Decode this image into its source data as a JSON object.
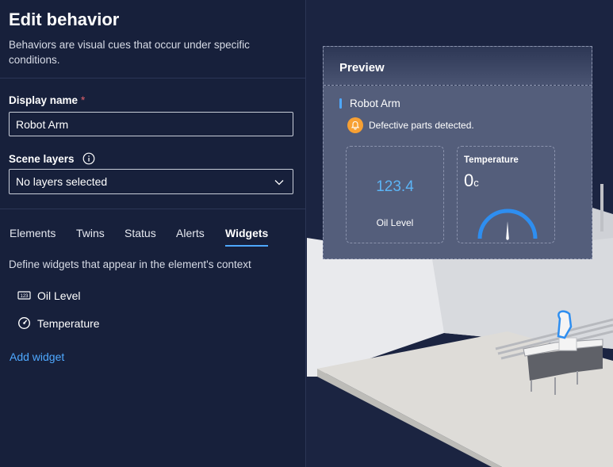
{
  "panel": {
    "title": "Edit behavior",
    "description": "Behaviors are visual cues that occur under specific conditions.",
    "display_name": {
      "label": "Display name",
      "required_mark": "*",
      "value": "Robot Arm"
    },
    "scene_layers": {
      "label": "Scene layers",
      "selected": "No layers selected"
    },
    "tabs": [
      {
        "label": "Elements",
        "active": false
      },
      {
        "label": "Twins",
        "active": false
      },
      {
        "label": "Status",
        "active": false
      },
      {
        "label": "Alerts",
        "active": false
      },
      {
        "label": "Widgets",
        "active": true
      }
    ],
    "tab_description": "Define widgets that appear in the element's context",
    "widgets": [
      {
        "label": "Oil Level",
        "icon": "number-display-icon"
      },
      {
        "label": "Temperature",
        "icon": "gauge-icon"
      }
    ],
    "add_widget_label": "Add widget"
  },
  "preview": {
    "title": "Preview",
    "element_name": "Robot Arm",
    "alert_text": "Defective parts detected.",
    "value_widget": {
      "value": "123.4",
      "label": "Oil Level"
    },
    "gauge_widget": {
      "title": "Temperature",
      "value": "0",
      "unit": "c",
      "needle_fraction": 0.5
    }
  },
  "colors": {
    "accent": "#4ea8ff",
    "panel_bg": "#17203b",
    "alert": "#f7a033",
    "value_text": "#5cb4f5"
  }
}
